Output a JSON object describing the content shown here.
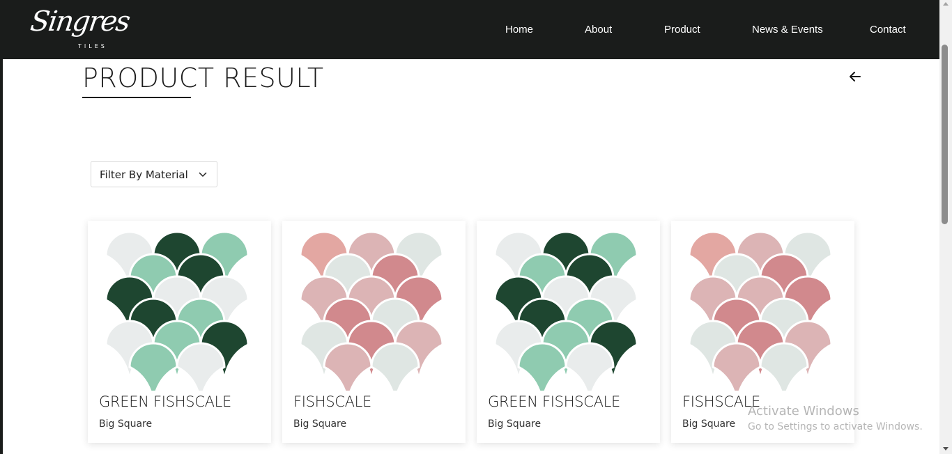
{
  "brand": {
    "script": "Singres",
    "sub": "TILES"
  },
  "nav": [
    {
      "label": "Home"
    },
    {
      "label": "About"
    },
    {
      "label": "Product"
    },
    {
      "label": "News & Events"
    },
    {
      "label": "Contact"
    }
  ],
  "page": {
    "title": "PRODUCT RESULT"
  },
  "filter": {
    "label": "Filter By Material"
  },
  "products": [
    {
      "name": "GREEN FISHSCALE",
      "subtitle": "Big Square",
      "palette": "green"
    },
    {
      "name": "FISHSCALE",
      "subtitle": "Big Square",
      "palette": "pink"
    },
    {
      "name": "GREEN FISHSCALE",
      "subtitle": "Big Square",
      "palette": "green"
    },
    {
      "name": "FISHSCALE",
      "subtitle": "Big Square",
      "palette": "pink"
    }
  ],
  "palettes": {
    "green": {
      "w": "#e9ecec",
      "d": "#1e4630",
      "m": "#8fcbb0"
    },
    "pink": {
      "p": "#e3a7a2",
      "l": "#dcb4b5",
      "r": "#d1898d",
      "g": "#dfe6e3"
    }
  },
  "watermark": {
    "title": "Activate Windows",
    "subtitle": "Go to Settings to activate Windows."
  },
  "colors": {
    "nav_bg": "#1a1c1b",
    "text": "#1b1b1b"
  }
}
